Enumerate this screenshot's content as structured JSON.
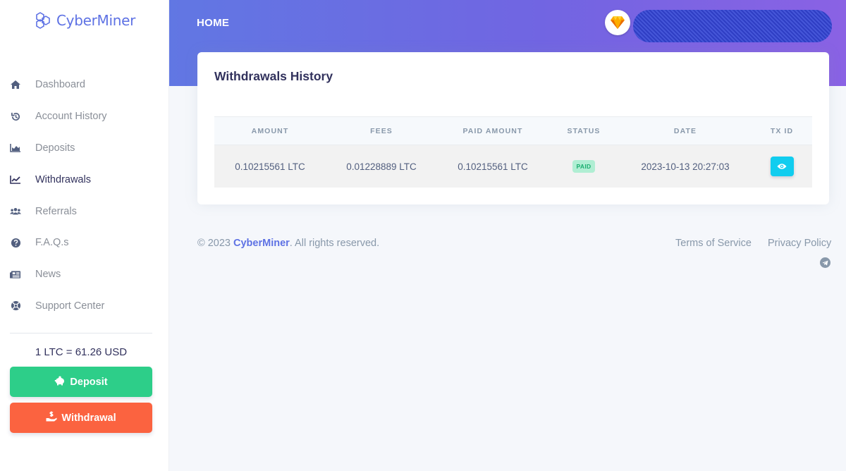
{
  "brand": {
    "name": "CyberMiner",
    "color": "#5e72e4"
  },
  "sidebar": {
    "items": [
      {
        "label": "Dashboard",
        "icon": "home-icon"
      },
      {
        "label": "Account History",
        "icon": "history-icon"
      },
      {
        "label": "Deposits",
        "icon": "area-chart-icon"
      },
      {
        "label": "Withdrawals",
        "icon": "line-chart-icon",
        "active": true
      },
      {
        "label": "Referrals",
        "icon": "users-icon"
      },
      {
        "label": "F.A.Q.s",
        "icon": "question-circle-icon"
      },
      {
        "label": "News",
        "icon": "newspaper-icon"
      },
      {
        "label": "Support Center",
        "icon": "life-ring-icon"
      }
    ],
    "rate": "1 LTC = 61.26 USD",
    "deposit_label": "Deposit",
    "withdrawal_label": "Withdrawal"
  },
  "header": {
    "title": "HOME",
    "avatar_icon": "sketch-diamond-icon"
  },
  "card": {
    "title": "Withdrawals History",
    "columns": [
      "AMOUNT",
      "FEES",
      "PAID AMOUNT",
      "STATUS",
      "DATE",
      "TX ID"
    ],
    "rows": [
      {
        "amount": "0.10215561 LTC",
        "fees": "0.01228889 LTC",
        "paid_amount": "0.10215561 LTC",
        "status": "PAID",
        "date": "2023-10-13 20:27:03",
        "txid_icon": "eye-icon"
      }
    ]
  },
  "footer": {
    "copy_prefix": "© 2023",
    "brand": "CyberMiner",
    "copy_suffix": ". All rights reserved.",
    "terms": "Terms of Service",
    "privacy": "Privacy Policy",
    "social_icon": "telegram-icon"
  },
  "colors": {
    "deposit": "#2dce89",
    "withdrawal": "#fb6340",
    "status_paid": "#1aae6f",
    "txid_button": "#11cdef"
  }
}
